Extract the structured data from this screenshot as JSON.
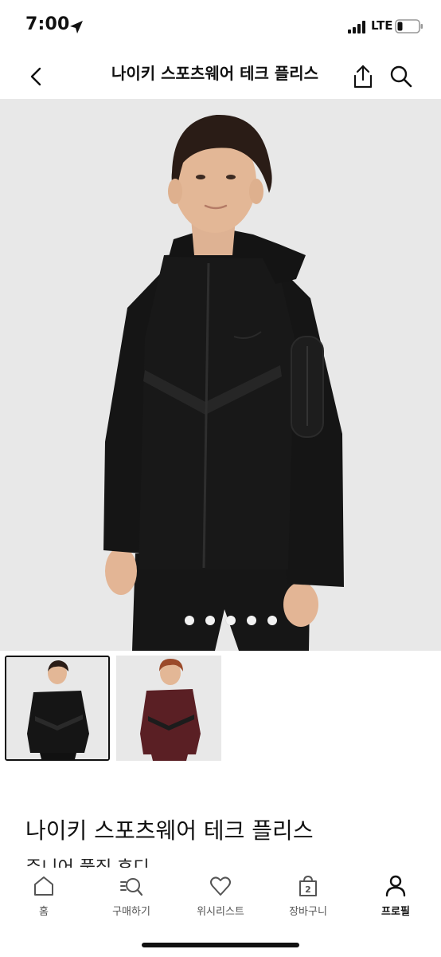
{
  "status_bar": {
    "time": "7:00",
    "network": "LTE"
  },
  "nav": {
    "title": "나이키 스포츠웨어 테크 플리스"
  },
  "gallery": {
    "page_count": 5,
    "current_page": 1,
    "selected_thumbnail": 1,
    "thumbnails": [
      {
        "name": "black-hoodie-variant",
        "color": "#1a1a1a"
      },
      {
        "name": "burgundy-hoodie-variant",
        "color": "#5a1f24"
      }
    ]
  },
  "product": {
    "title": "나이키 스포츠웨어 테크 플리스",
    "subtitle": "주니어 풀집 후디"
  },
  "tab_bar": {
    "items": [
      {
        "label": "홈",
        "icon": "home-icon",
        "active": false
      },
      {
        "label": "구매하기",
        "icon": "search-list-icon",
        "active": false
      },
      {
        "label": "위시리스트",
        "icon": "heart-icon",
        "active": false
      },
      {
        "label": "장바구니",
        "icon": "bag-icon",
        "badge": "2",
        "active": false
      },
      {
        "label": "프로필",
        "icon": "person-icon",
        "active": true
      }
    ]
  }
}
